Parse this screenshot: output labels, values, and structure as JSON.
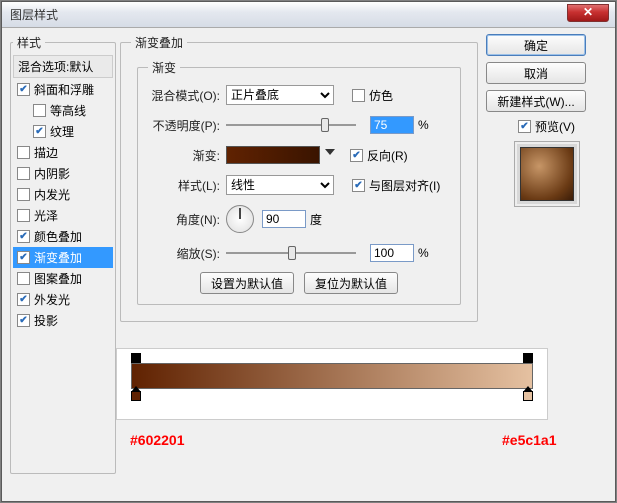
{
  "window": {
    "title": "图层样式"
  },
  "left": {
    "header": "样式",
    "blend_default": "混合选项:默认",
    "items": [
      {
        "label": "斜面和浮雕",
        "checked": true,
        "indent": false
      },
      {
        "label": "等高线",
        "checked": false,
        "indent": true
      },
      {
        "label": "纹理",
        "checked": true,
        "indent": true
      },
      {
        "label": "描边",
        "checked": false,
        "indent": false
      },
      {
        "label": "内阴影",
        "checked": false,
        "indent": false
      },
      {
        "label": "内发光",
        "checked": false,
        "indent": false
      },
      {
        "label": "光泽",
        "checked": false,
        "indent": false
      },
      {
        "label": "颜色叠加",
        "checked": true,
        "indent": false
      },
      {
        "label": "渐变叠加",
        "checked": true,
        "indent": false,
        "selected": true
      },
      {
        "label": "图案叠加",
        "checked": false,
        "indent": false
      },
      {
        "label": "外发光",
        "checked": true,
        "indent": false
      },
      {
        "label": "投影",
        "checked": true,
        "indent": false
      }
    ]
  },
  "mid": {
    "group_title": "渐变叠加",
    "inner_title": "渐变",
    "blend_mode_label": "混合模式(O):",
    "blend_mode_value": "正片叠底",
    "dither_label": "仿色",
    "opacity_label": "不透明度(P):",
    "opacity_value": "75",
    "pct": "%",
    "gradient_label": "渐变:",
    "reverse_label": "反向(R)",
    "style_label": "样式(L):",
    "style_value": "线性",
    "align_label": "与图层对齐(I)",
    "angle_label": "角度(N):",
    "angle_value": "90",
    "angle_unit": "度",
    "scale_label": "缩放(S):",
    "scale_value": "100",
    "btn_set_default": "设置为默认值",
    "btn_reset_default": "复位为默认值"
  },
  "right": {
    "ok": "确定",
    "cancel": "取消",
    "new_style": "新建样式(W)...",
    "preview_label": "预览(V)"
  },
  "editor": {
    "hex_left": "#602201",
    "hex_right": "#e5c1a1"
  },
  "chart_data": {
    "type": "gradient",
    "stops": [
      {
        "position": 0,
        "color": "#602201"
      },
      {
        "position": 100,
        "color": "#e5c1a1"
      }
    ]
  }
}
